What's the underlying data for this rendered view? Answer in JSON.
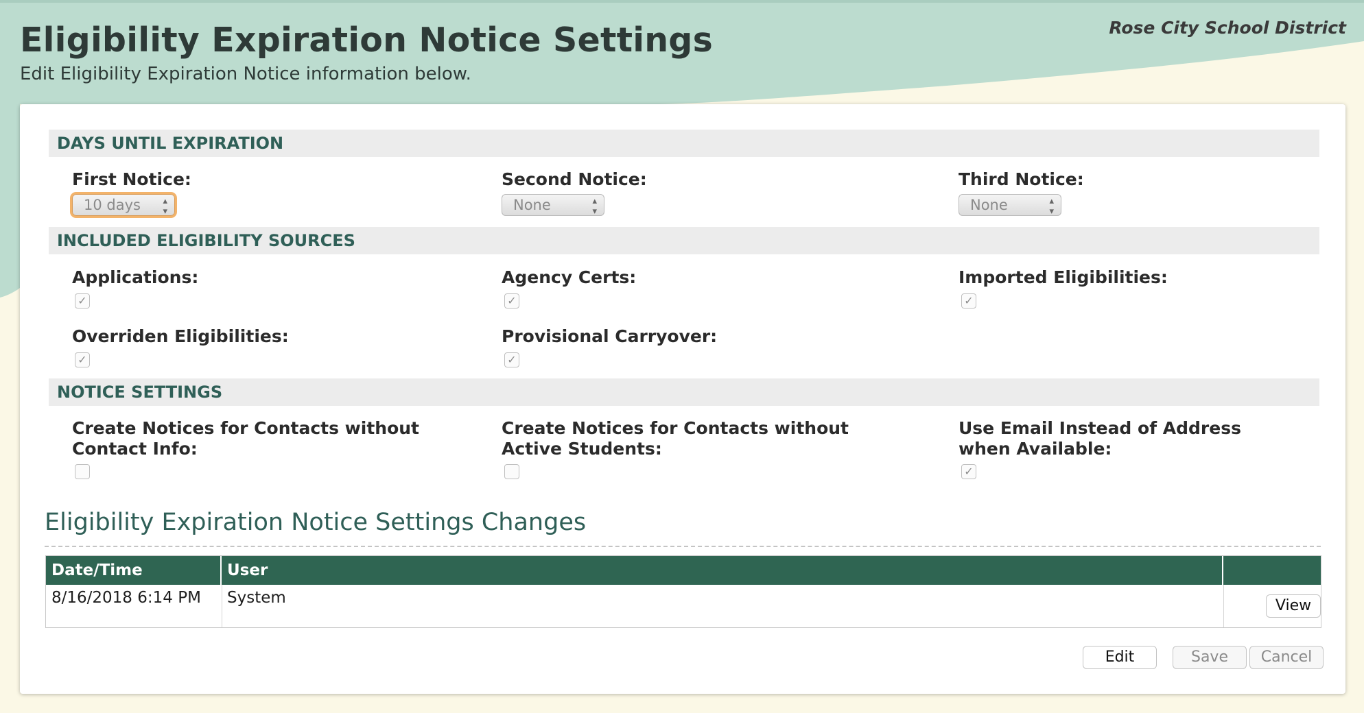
{
  "district": "Rose City School District",
  "page": {
    "title": "Eligibility Expiration Notice Settings",
    "subtitle": "Edit Eligibility Expiration Notice information below."
  },
  "sections": {
    "days": {
      "title": "DAYS UNTIL EXPIRATION",
      "first_label": "First Notice:",
      "first_value": "10 days",
      "second_label": "Second Notice:",
      "second_value": "None",
      "third_label": "Third Notice:",
      "third_value": "None"
    },
    "sources": {
      "title": "INCLUDED ELIGIBILITY SOURCES",
      "applications_label": "Applications:",
      "applications_checked": true,
      "agency_label": "Agency Certs:",
      "agency_checked": true,
      "imported_label": "Imported Eligibilities:",
      "imported_checked": true,
      "overriden_label": "Overriden Eligibilities:",
      "overriden_checked": true,
      "provisional_label": "Provisional Carryover:",
      "provisional_checked": true
    },
    "notice": {
      "title": "NOTICE SETTINGS",
      "no_contact_label": "Create Notices for Contacts without Contact Info:",
      "no_contact_checked": false,
      "no_students_label": "Create Notices for Contacts without Active Students:",
      "no_students_checked": false,
      "use_email_label": "Use Email Instead of Address when Available:",
      "use_email_checked": true
    }
  },
  "changes": {
    "title": "Eligibility Expiration Notice Settings Changes",
    "columns": [
      "Date/Time",
      "User",
      ""
    ],
    "rows": [
      {
        "datetime": "8/16/2018 6:14 PM",
        "user": "System",
        "action": "View"
      }
    ]
  },
  "buttons": {
    "edit": "Edit",
    "save": "Save",
    "cancel": "Cancel"
  },
  "colors": {
    "header_green": "#2f6552",
    "section_text": "#2f5f57",
    "wave": "#bcdccf",
    "cream": "#fbf8e6"
  },
  "icons": {
    "checkmark": "✓",
    "select_arrows": "▴▾"
  }
}
